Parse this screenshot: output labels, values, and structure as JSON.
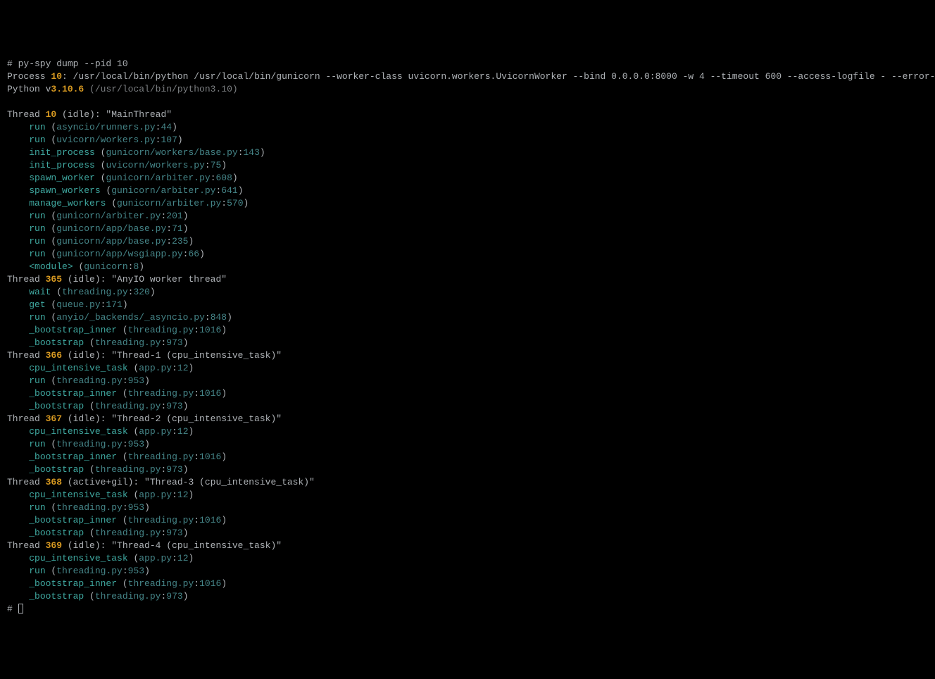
{
  "command": "# py-spy dump --pid 10",
  "process_line_prefix": "Process ",
  "process_pid": "10",
  "process_line_rest": ": /usr/local/bin/python /usr/local/bin/gunicorn --worker-class uvicorn.workers.UvicornWorker --bind 0.0.0.0:8000 -w 4 --timeout 600 --access-logfile - --error-logfile - app:app",
  "python_prefix": "Python v",
  "python_version": "3.10.6",
  "python_path": " (/usr/local/bin/python3.10)",
  "threads": [
    {
      "id": "10",
      "status": "(idle)",
      "name": "\"MainThread\"",
      "frames": [
        {
          "func": "run",
          "path": "asyncio/runners.py",
          "ln": "44"
        },
        {
          "func": "run",
          "path": "uvicorn/workers.py",
          "ln": "107"
        },
        {
          "func": "init_process",
          "path": "gunicorn/workers/base.py",
          "ln": "143"
        },
        {
          "func": "init_process",
          "path": "uvicorn/workers.py",
          "ln": "75"
        },
        {
          "func": "spawn_worker",
          "path": "gunicorn/arbiter.py",
          "ln": "608"
        },
        {
          "func": "spawn_workers",
          "path": "gunicorn/arbiter.py",
          "ln": "641"
        },
        {
          "func": "manage_workers",
          "path": "gunicorn/arbiter.py",
          "ln": "570"
        },
        {
          "func": "run",
          "path": "gunicorn/arbiter.py",
          "ln": "201"
        },
        {
          "func": "run",
          "path": "gunicorn/app/base.py",
          "ln": "71"
        },
        {
          "func": "run",
          "path": "gunicorn/app/base.py",
          "ln": "235"
        },
        {
          "func": "run",
          "path": "gunicorn/app/wsgiapp.py",
          "ln": "66"
        },
        {
          "func": "<module>",
          "path": "gunicorn",
          "ln": "8"
        }
      ]
    },
    {
      "id": "365",
      "status": "(idle)",
      "name": "\"AnyIO worker thread\"",
      "frames": [
        {
          "func": "wait",
          "path": "threading.py",
          "ln": "320"
        },
        {
          "func": "get",
          "path": "queue.py",
          "ln": "171"
        },
        {
          "func": "run",
          "path": "anyio/_backends/_asyncio.py",
          "ln": "848"
        },
        {
          "func": "_bootstrap_inner",
          "path": "threading.py",
          "ln": "1016"
        },
        {
          "func": "_bootstrap",
          "path": "threading.py",
          "ln": "973"
        }
      ]
    },
    {
      "id": "366",
      "status": "(idle)",
      "name": "\"Thread-1 (cpu_intensive_task)\"",
      "frames": [
        {
          "func": "cpu_intensive_task",
          "path": "app.py",
          "ln": "12"
        },
        {
          "func": "run",
          "path": "threading.py",
          "ln": "953"
        },
        {
          "func": "_bootstrap_inner",
          "path": "threading.py",
          "ln": "1016"
        },
        {
          "func": "_bootstrap",
          "path": "threading.py",
          "ln": "973"
        }
      ]
    },
    {
      "id": "367",
      "status": "(idle)",
      "name": "\"Thread-2 (cpu_intensive_task)\"",
      "frames": [
        {
          "func": "cpu_intensive_task",
          "path": "app.py",
          "ln": "12"
        },
        {
          "func": "run",
          "path": "threading.py",
          "ln": "953"
        },
        {
          "func": "_bootstrap_inner",
          "path": "threading.py",
          "ln": "1016"
        },
        {
          "func": "_bootstrap",
          "path": "threading.py",
          "ln": "973"
        }
      ]
    },
    {
      "id": "368",
      "status": "(active+gil)",
      "name": "\"Thread-3 (cpu_intensive_task)\"",
      "frames": [
        {
          "func": "cpu_intensive_task",
          "path": "app.py",
          "ln": "12"
        },
        {
          "func": "run",
          "path": "threading.py",
          "ln": "953"
        },
        {
          "func": "_bootstrap_inner",
          "path": "threading.py",
          "ln": "1016"
        },
        {
          "func": "_bootstrap",
          "path": "threading.py",
          "ln": "973"
        }
      ]
    },
    {
      "id": "369",
      "status": "(idle)",
      "name": "\"Thread-4 (cpu_intensive_task)\"",
      "frames": [
        {
          "func": "cpu_intensive_task",
          "path": "app.py",
          "ln": "12"
        },
        {
          "func": "run",
          "path": "threading.py",
          "ln": "953"
        },
        {
          "func": "_bootstrap_inner",
          "path": "threading.py",
          "ln": "1016"
        },
        {
          "func": "_bootstrap",
          "path": "threading.py",
          "ln": "973"
        }
      ]
    }
  ],
  "labels": {
    "thread": "Thread"
  },
  "prompt_final": "# "
}
